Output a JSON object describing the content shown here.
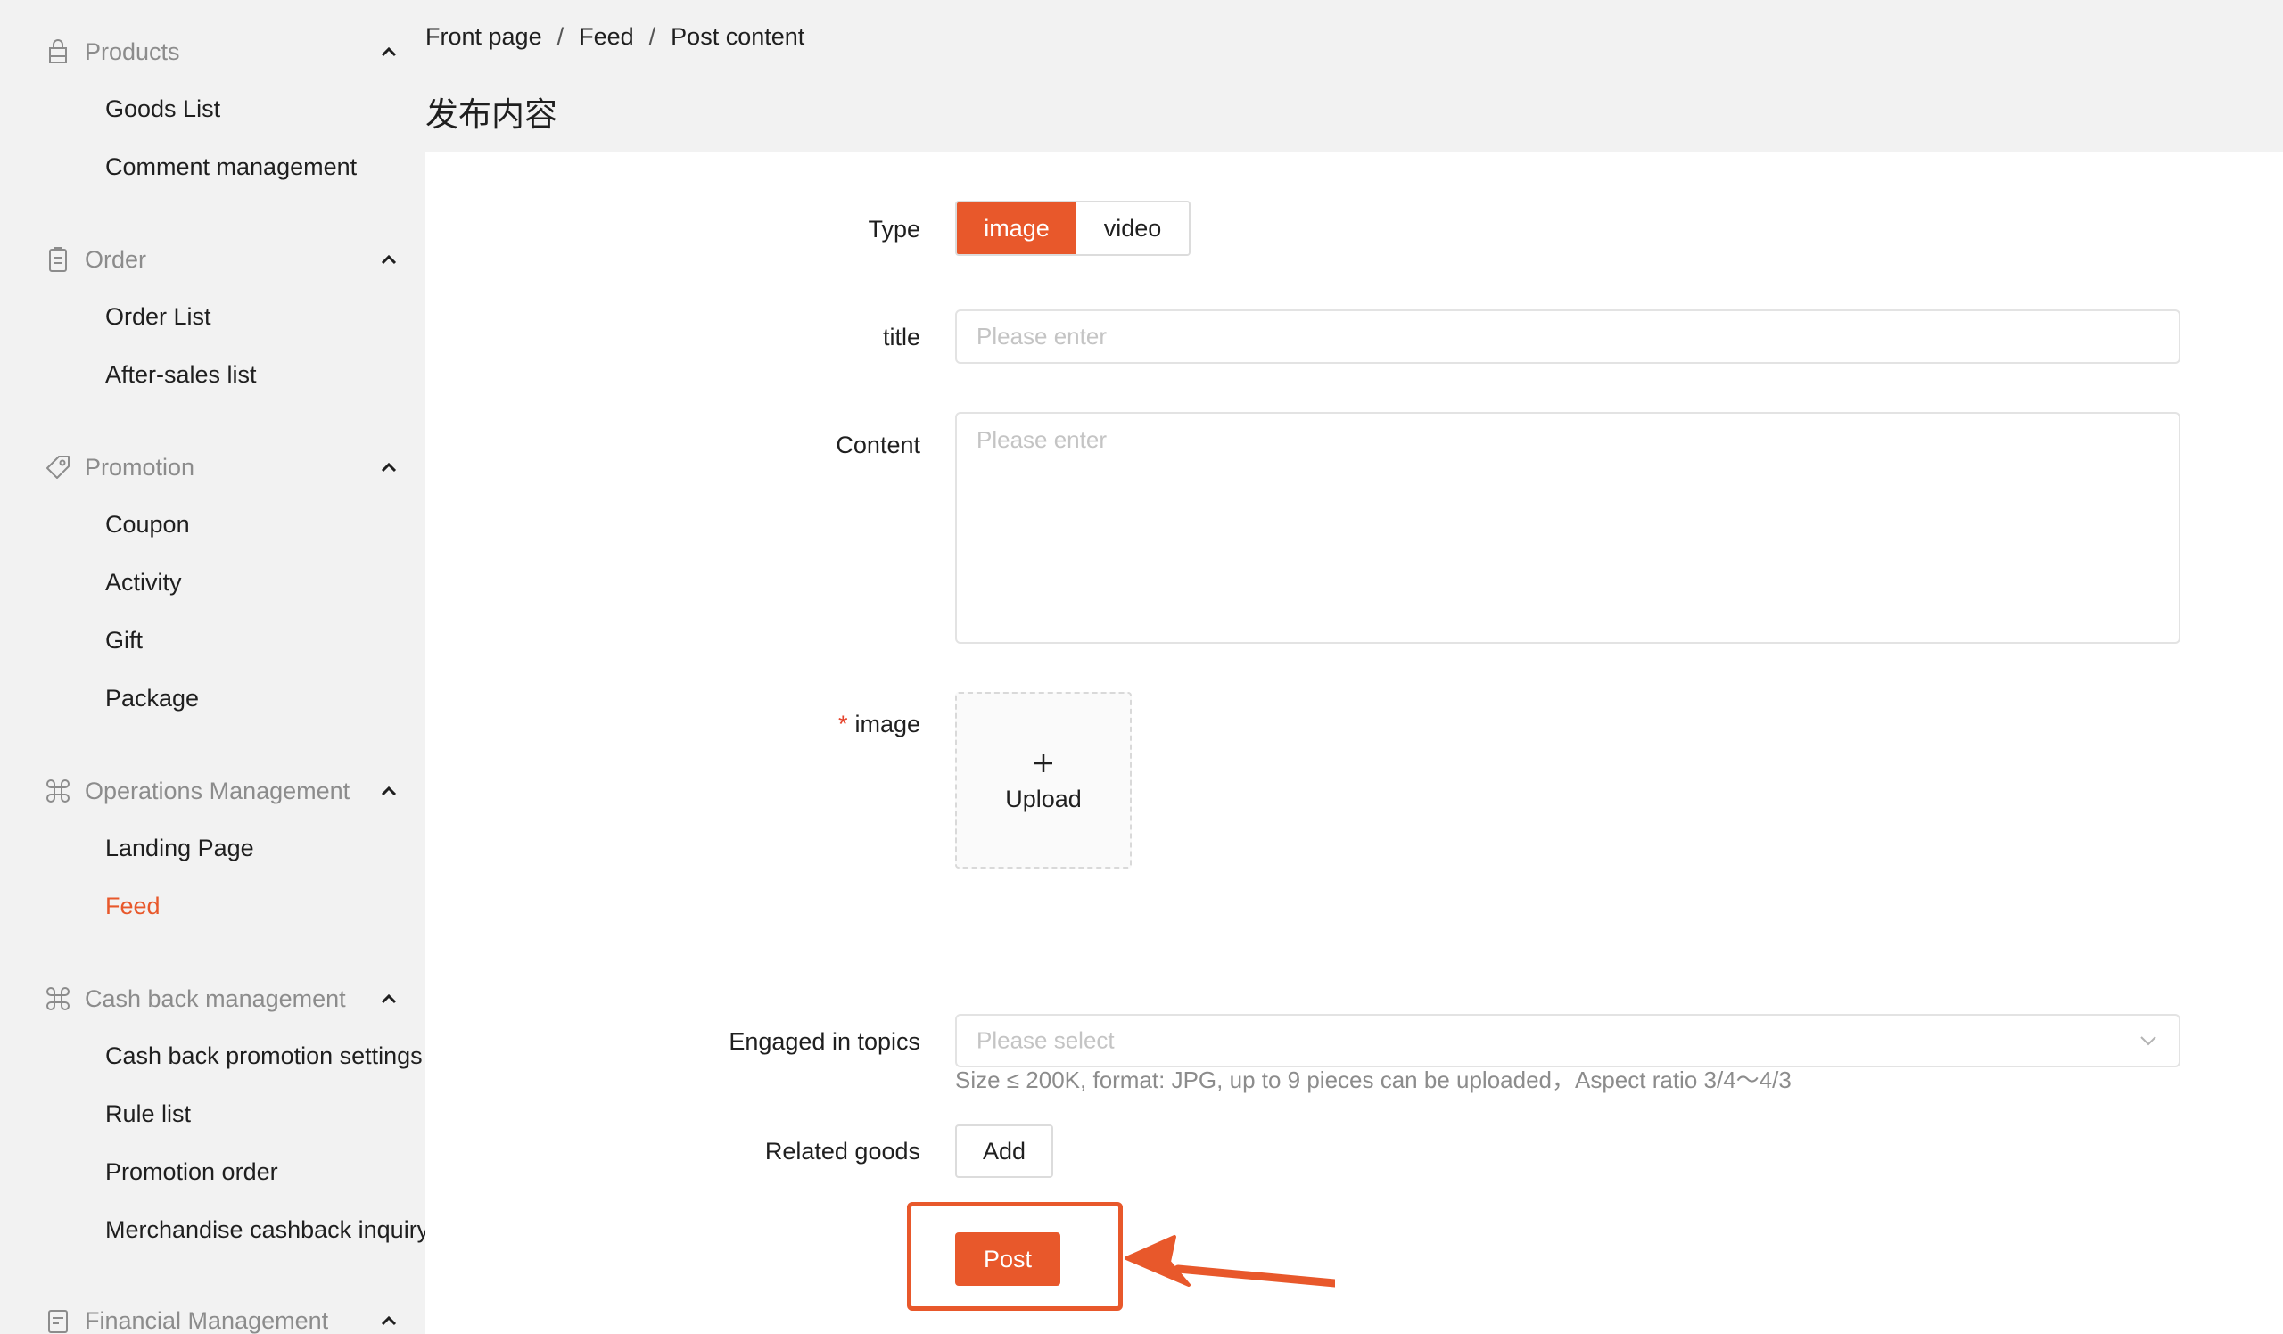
{
  "sidebar": {
    "groups": [
      {
        "label": "Products",
        "icon": "bag-icon",
        "items": [
          "Goods List",
          "Comment management"
        ]
      },
      {
        "label": "Order",
        "icon": "clipboard-icon",
        "items": [
          "Order List",
          "After-sales list"
        ]
      },
      {
        "label": "Promotion",
        "icon": "tag-icon",
        "items": [
          "Coupon",
          "Activity",
          "Gift",
          "Package"
        ]
      },
      {
        "label": "Operations Management",
        "icon": "command-icon",
        "items": [
          "Landing Page",
          "Feed"
        ]
      },
      {
        "label": "Cash back management",
        "icon": "command-icon",
        "items": [
          "Cash back promotion settings",
          "Rule list",
          "Promotion order",
          "Merchandise cashback inquiry"
        ]
      },
      {
        "label": "Financial Management",
        "icon": "finance-doc-icon",
        "items": []
      }
    ],
    "active_item": "Feed"
  },
  "breadcrumb": [
    "Front page",
    "Feed",
    "Post content"
  ],
  "breadcrumb_separator": "/",
  "page_title": "发布内容",
  "form": {
    "type": {
      "label": "Type",
      "options": [
        "image",
        "video"
      ],
      "selected": "image"
    },
    "title": {
      "label": "title",
      "placeholder": "Please enter",
      "value": ""
    },
    "content": {
      "label": "Content",
      "placeholder": "Please enter",
      "value": ""
    },
    "image": {
      "label": "image",
      "required_mark": "*",
      "upload_label": "Upload",
      "hint": "Size ≤ 200K, format: JPG, up to 9 pieces can be uploaded，Aspect ratio 3/4～4/3"
    },
    "topics": {
      "label": "Engaged in topics",
      "placeholder": "Please select"
    },
    "goods": {
      "label": "Related goods",
      "add_label": "Add"
    },
    "submit_label": "Post"
  },
  "colors": {
    "accent": "#e8582b",
    "sidebar_bg": "#f2f2f2",
    "card_bg": "#ffffff",
    "muted_text": "#8c8c8c",
    "required": "#e5432c"
  }
}
